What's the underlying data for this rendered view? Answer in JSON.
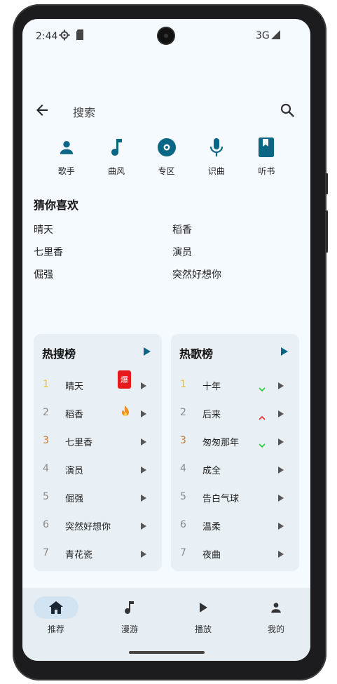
{
  "status": {
    "time": "2:44",
    "network": "3G"
  },
  "topbar": {
    "title": "搜索"
  },
  "categories": [
    {
      "label": "歌手",
      "icon": "person-icon"
    },
    {
      "label": "曲风",
      "icon": "music-note-icon"
    },
    {
      "label": "专区",
      "icon": "disc-icon"
    },
    {
      "label": "识曲",
      "icon": "microphone-icon"
    },
    {
      "label": "听书",
      "icon": "book-icon"
    }
  ],
  "guess": {
    "title": "猜你喜欢",
    "items": [
      "晴天",
      "稻香",
      "七里香",
      "演员",
      "倔强",
      "突然好想你"
    ]
  },
  "hot_search": {
    "title": "热搜榜",
    "rows": [
      {
        "rank": "1",
        "name": "晴天",
        "badge": "爆"
      },
      {
        "rank": "2",
        "name": "稻香",
        "badge": "fire"
      },
      {
        "rank": "3",
        "name": "七里香"
      },
      {
        "rank": "4",
        "name": "演员"
      },
      {
        "rank": "5",
        "name": "倔强"
      },
      {
        "rank": "6",
        "name": "突然好想你"
      },
      {
        "rank": "7",
        "name": "青花瓷"
      }
    ]
  },
  "hot_songs": {
    "title": "热歌榜",
    "rows": [
      {
        "rank": "1",
        "name": "十年",
        "trend": "down"
      },
      {
        "rank": "2",
        "name": "后来",
        "trend": "up"
      },
      {
        "rank": "3",
        "name": "匆匆那年",
        "trend": "down"
      },
      {
        "rank": "4",
        "name": "成全"
      },
      {
        "rank": "5",
        "name": "告白气球"
      },
      {
        "rank": "6",
        "name": "温柔"
      },
      {
        "rank": "7",
        "name": "夜曲"
      }
    ]
  },
  "nav": [
    {
      "label": "推荐",
      "icon": "home-icon",
      "active": true
    },
    {
      "label": "漫游",
      "icon": "music-note-icon"
    },
    {
      "label": "播放",
      "icon": "play-icon"
    },
    {
      "label": "我的",
      "icon": "person-icon"
    }
  ],
  "colors": {
    "accent": "#0a6685",
    "rank1": "#f2c11b",
    "rank3": "#c8782e",
    "rank_other": "#8a8a8a",
    "badge_red": "#e8191c",
    "trend_up": "#e53935",
    "trend_down": "#2ecc40"
  }
}
